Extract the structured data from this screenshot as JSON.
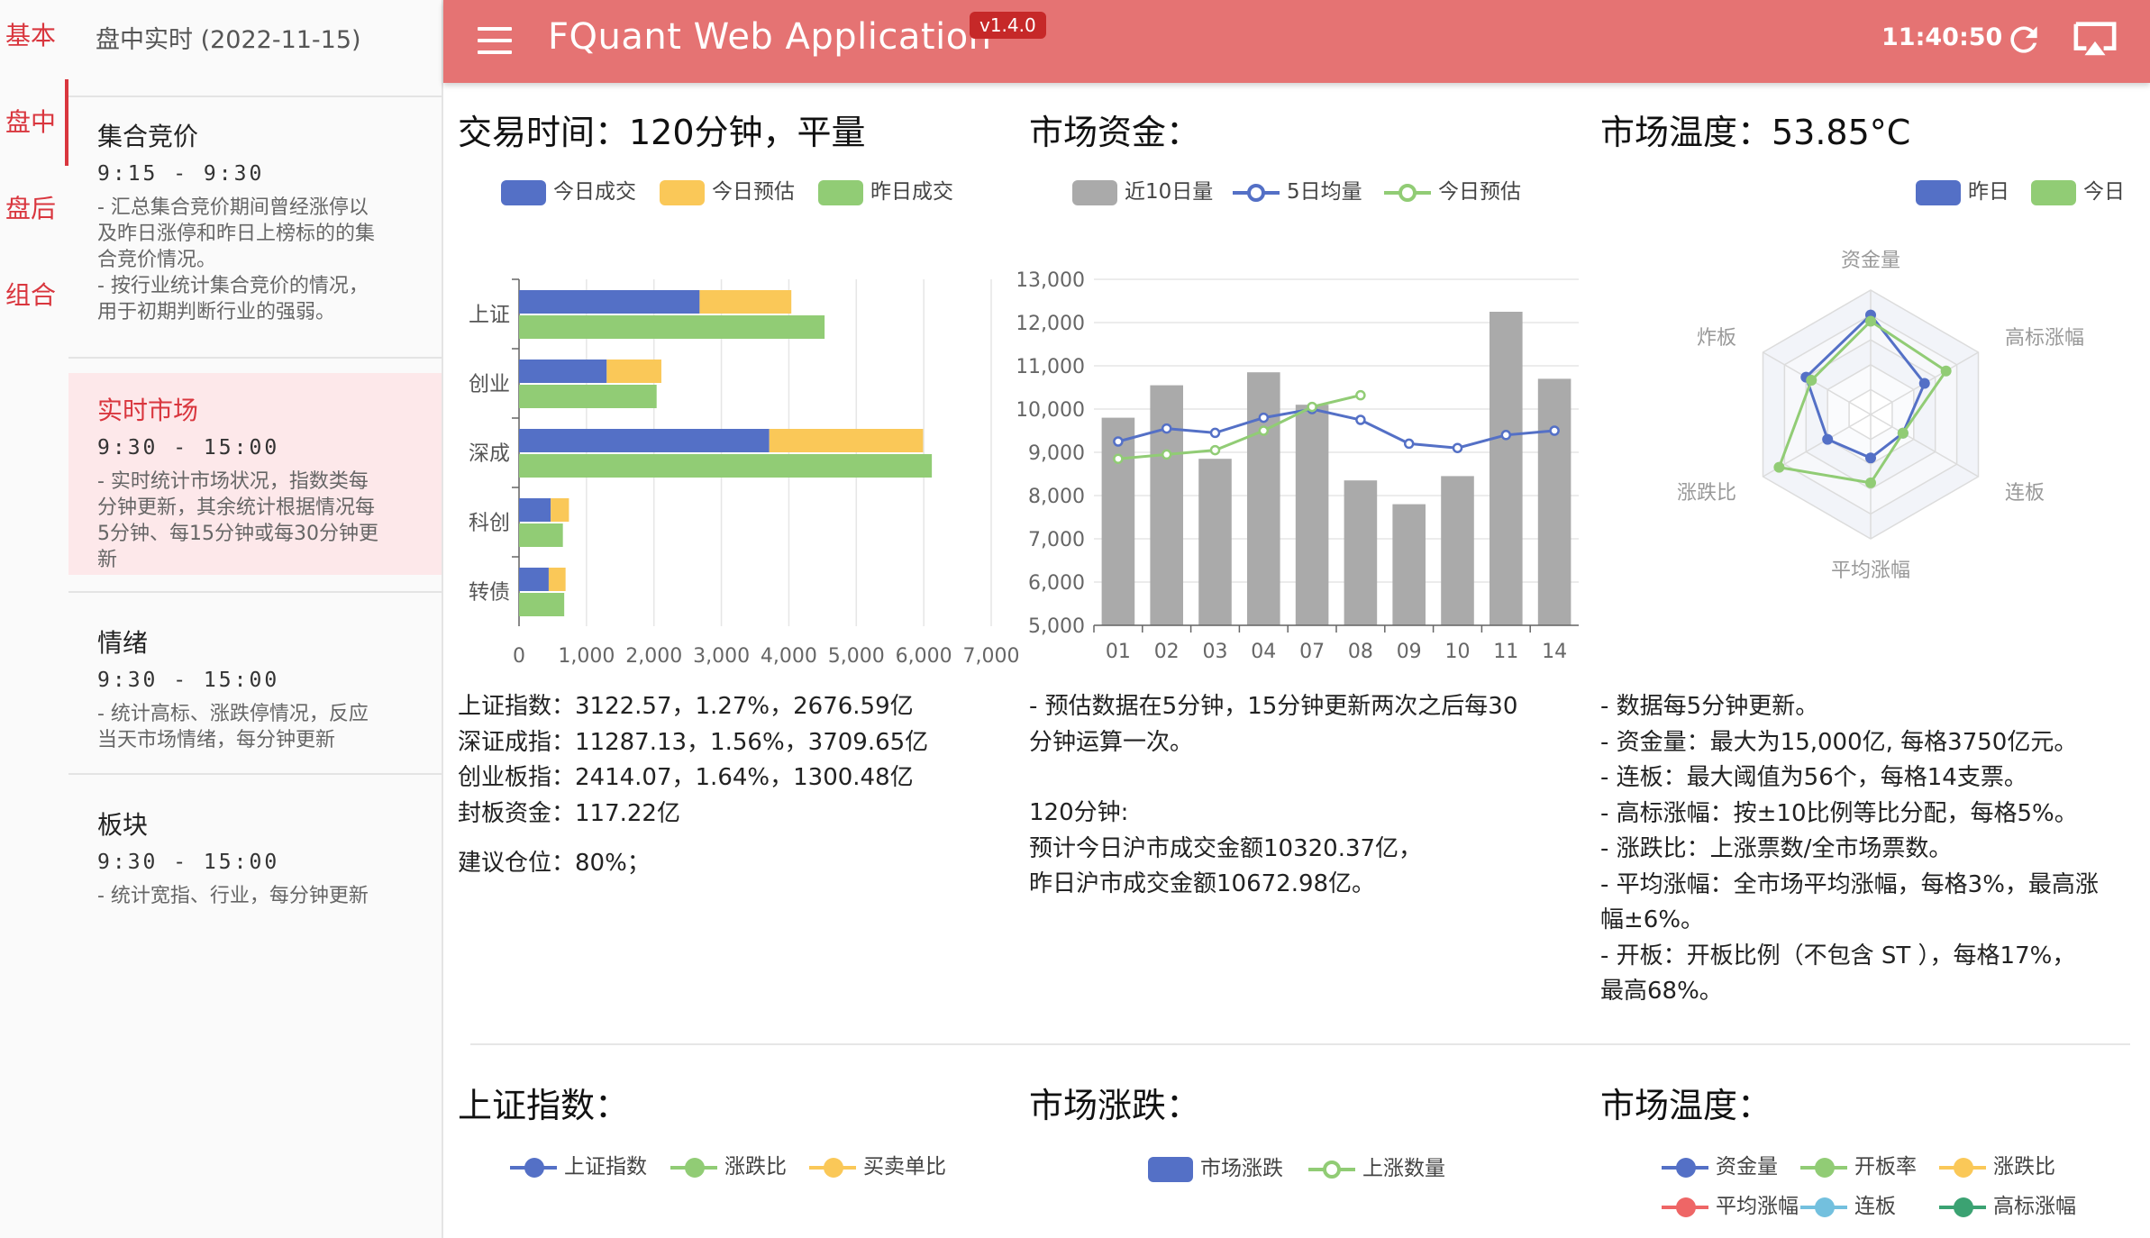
{
  "rail": {
    "tabs": [
      "基本",
      "盘中",
      "盘后",
      "组合"
    ],
    "active_index": 1
  },
  "drawer": {
    "header": "盘中实时 (2022-11-15)",
    "items": [
      {
        "title": "集合竞价",
        "time": "9:15 - 9:30",
        "desc": [
          "- 汇总集合竞价期间曾经涨停以",
          "及昨日涨停和昨日上榜标的的集",
          "合竞价情况。",
          "- 按行业统计集合竞价的情况，",
          "用于初期判断行业的强弱。"
        ]
      },
      {
        "title": "实时市场",
        "time": "9:30 - 15:00",
        "desc": [
          "- 实时统计市场状况，指数类每",
          "分钟更新，其余统计根据情况每",
          "5分钟、每15分钟或每30分钟更",
          "新"
        ]
      },
      {
        "title": "情绪",
        "time": "9:30 - 15:00",
        "desc": [
          "- 统计高标、涨跌停情况，反应",
          "当天市场情绪，每分钟更新"
        ]
      },
      {
        "title": "板块",
        "time": "9:30 - 15:00",
        "desc": [
          "- 统计宽指、行业，每分钟更新"
        ]
      }
    ],
    "active_index": 1
  },
  "appbar": {
    "title": "FQuant Web Application",
    "version": "v1.4.0",
    "clock": "11:40:50"
  },
  "panels": {
    "trading": {
      "title": "交易时间：120分钟，平量",
      "legend": [
        "今日成交",
        "今日预估",
        "昨日成交"
      ],
      "notes": [
        "上证指数：3122.57，1.27%，2676.59亿",
        "深证成指：11287.13，1.56%，3709.65亿",
        "创业板指：2414.07，1.64%，1300.48亿",
        "封板资金：117.22亿"
      ],
      "advice": "建议仓位：80%；"
    },
    "funds": {
      "title": "市场资金：",
      "legend": [
        "近10日量",
        "5日均量",
        "今日预估"
      ],
      "notes": [
        "- 预估数据在5分钟，15分钟更新两次之后每30",
        "分钟运算一次。",
        "",
        "120分钟:",
        "预计今日沪市成交金额10320.37亿，",
        "昨日沪市成交金额10672.98亿。"
      ]
    },
    "temperature": {
      "title": "市场温度：53.85°C",
      "legend": [
        "昨日",
        "今日"
      ],
      "notes": [
        "- 数据每5分钟更新。",
        "- 资金量：最大为15,000亿, 每格3750亿元。",
        "- 连板：最大阈值为56个，每格14支票。",
        "- 高标涨幅：按±10比例等比分配，每格5%。",
        "- 涨跌比：上涨票数/全市场票数。",
        "- 平均涨幅：全市场平均涨幅，每格3%，最高涨",
        "幅±6%。",
        "- 开板：开板比例（不包含 ST ），每格17%，",
        "最高68%。"
      ]
    },
    "index_panel": {
      "title": "上证指数：",
      "legend": [
        "上证指数",
        "涨跌比",
        "买卖单比"
      ]
    },
    "updown_panel": {
      "title": "市场涨跌：",
      "legend": [
        "市场涨跌",
        "上涨数量"
      ]
    },
    "temp_panel2": {
      "title": "市场温度：",
      "legend": [
        "资金量",
        "开板率",
        "涨跌比",
        "平均涨幅",
        "连板",
        "高标涨幅"
      ]
    }
  },
  "colors": {
    "blue": "#5470c6",
    "yellow": "#fac858",
    "green": "#91cc75",
    "gray": "#aaaaaa",
    "red": "#ee6666",
    "cyan": "#73c0de",
    "teal": "#3ba272",
    "appbar": "#e57373",
    "accent": "#d9363e"
  },
  "chart_data": [
    {
      "type": "bar",
      "orientation": "horizontal",
      "stacked_series": [
        "今日成交",
        "今日预估"
      ],
      "categories": [
        "上证",
        "创业",
        "深成",
        "科创",
        "转债"
      ],
      "series": [
        {
          "name": "今日成交",
          "values": [
            2677,
            1300,
            3710,
            470,
            440
          ]
        },
        {
          "name": "今日预估",
          "values": [
            1360,
            810,
            2280,
            270,
            250
          ]
        },
        {
          "name": "昨日成交",
          "values": [
            4530,
            2040,
            6120,
            650,
            670
          ]
        }
      ],
      "xlim": [
        0,
        7000
      ],
      "xticks": [
        "0",
        "1,000",
        "2,000",
        "3,000",
        "4,000",
        "5,000",
        "6,000",
        "7,000"
      ]
    },
    {
      "type": "bar",
      "categories": [
        "01",
        "02",
        "03",
        "04",
        "07",
        "08",
        "09",
        "10",
        "11",
        "14"
      ],
      "series": [
        {
          "name": "近10日量",
          "type": "bar",
          "values": [
            9800,
            10550,
            8850,
            10850,
            10100,
            8350,
            7800,
            8450,
            12250,
            10700
          ]
        },
        {
          "name": "5日均量",
          "type": "line",
          "values": [
            9250,
            9550,
            9450,
            9800,
            10000,
            9750,
            9200,
            9100,
            9400,
            9500
          ]
        },
        {
          "name": "今日预估",
          "type": "line",
          "values": [
            8850,
            8950,
            9050,
            9500,
            10050,
            10320
          ]
        }
      ],
      "ylim": [
        5000,
        13000
      ],
      "yticks": [
        "5,000",
        "6,000",
        "7,000",
        "8,000",
        "9,000",
        "10,000",
        "11,000",
        "12,000",
        "13,000"
      ]
    },
    {
      "type": "radar",
      "indicators": [
        "资金量",
        "高标涨幅",
        "连板",
        "平均涨幅",
        "涨跌比",
        "炸板"
      ],
      "series": [
        {
          "name": "昨日",
          "values": [
            0.8,
            0.5,
            0.3,
            0.35,
            0.4,
            0.6
          ]
        },
        {
          "name": "今日",
          "values": [
            0.75,
            0.7,
            0.3,
            0.55,
            0.85,
            0.55
          ]
        }
      ]
    }
  ]
}
